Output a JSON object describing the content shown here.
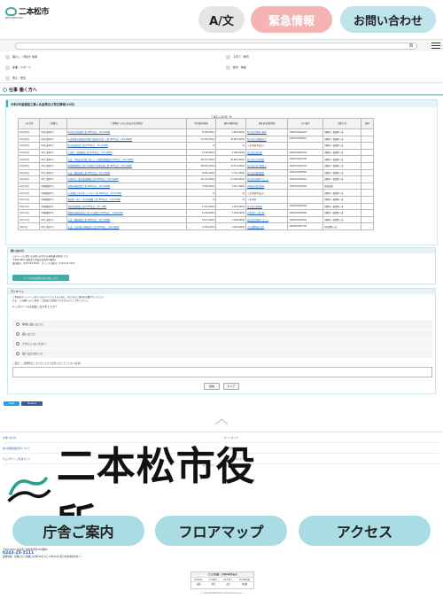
{
  "header": {
    "logo_text": "二本松市",
    "logo_sub": "NIHONMATSU",
    "lang_button": "A/文",
    "emergency_button": "緊急情報",
    "contact_button": "お問い合わせ"
  },
  "search": {
    "placeholder": "",
    "menu_label": "メニュー"
  },
  "category_nav": [
    {
      "label": "暮らし・手続き 情報"
    },
    {
      "label": "子育て・教育"
    },
    {
      "label": "産業・スポーツ"
    },
    {
      "label": "観光・物産"
    },
    {
      "label": "安心・安全"
    }
  ],
  "page_title": "仕事 働く方へ",
  "main": {
    "heading": "令和2年度建設工事入札結果及び発注情報(10月)",
    "caption": "工事等入札結果一覧",
    "columns": [
      "入札日等",
      "工事番号",
      "工事種名 [入札公告及び発注情報]",
      "予定価格(税抜)",
      "落札金額(税抜)",
      "落札者(結果詳細)",
      "法人番号",
      "契約方法",
      "備考"
    ],
    "rows": [
      [
        "10月26日",
        "2R水道第3号",
        "県水取水路耐震工事 [PDF形式：222.32KB]",
        "8,340,000円",
        "5,800,000円",
        "株式会社野崎工務所",
        "1000001009470",
        "制限付一般競争入札",
        ""
      ],
      [
        "10月26日",
        "2R水道第3号",
        "水道事業水資源保全事業 (東部浄水場) 工事 [PDF形式：219.69KB]",
        "53,050,000円",
        "45,800,000円",
        "株式会社安積組ほか",
        "5080001009819",
        "制限付一般競争入札",
        ""
      ],
      [
        "10月26日",
        "2R水道第3号",
        "配水施設修繕工事 [PDF形式：227.67KB]",
        "-円",
        "-円",
        "入札不調(不成立)",
        "-",
        "制限付一般競争入札",
        ""
      ],
      [
        "10月26日",
        "2R土木第3号",
        "土部里・道路整備工事 [PDF形式：217.99KB]",
        "4,550,000円",
        "4,480,000円",
        "株式会社清水組",
        "1000001009478",
        "制限付一般競争入札",
        ""
      ],
      [
        "10月26日",
        "2R土木第3号",
        "市道・学校安全対策工事 (入・供用施設整備) [PDF形式：222.58KB]",
        "28,537,000円",
        "20,800,000円",
        "株式会社丸実建設",
        "1000001005430",
        "制限付一般競争入札",
        ""
      ],
      [
        "10月26日",
        "2R土木第3号",
        "幹線管路施設工事 (大谷地区) 県道拡幅工事 [PDF形式：216.48KB]",
        "38,636,000円",
        "33,579,000円",
        "株式会社宮大建設工",
        "1000001007018",
        "制限付一般競争入札",
        ""
      ],
      [
        "10月26日",
        "2R土木第3号",
        "市道・舗装補修工事 [PDF形式：221.36KB]",
        "8,060,000円",
        "5,711,000円",
        "株式会社藤田建設",
        "1000001006856",
        "制限付一般競争入札",
        ""
      ],
      [
        "10月26日",
        "2R土木第3号",
        "市営住宅・集合施設整備工事 [PDF形式：223.16KB]",
        "14,521,000円",
        "14,000,000円",
        "株式会社新興アスコン",
        "1000001009516",
        "制限付一般競争入札",
        ""
      ],
      [
        "10月16日",
        "2R建築第3号",
        "道路区画線設置工事 [PDF形式：219.98KB]",
        "3,500,000円",
        "3,811,000円",
        "有限会社渡辺塗装",
        "1000001005834",
        "随意契約",
        ""
      ],
      [
        "10月12日",
        "2R建築第3号",
        "市道舗装工事水道 (上下水) 工事 [PDF形式：220.52KB]",
        "-円",
        "-円",
        "入札不調(不成立)",
        "-",
        "制限付一般競争入札",
        ""
      ],
      [
        "10月12日",
        "2R建築第3号",
        "東和第一排水・排水路整備工事 [PDF形式：218.39KB]",
        "-円",
        "-円",
        "入札不調",
        "-",
        "制限付一般競争入札",
        ""
      ],
      [
        "10月12日",
        "2R建築第3号",
        "消防施設整備工事 [PDF形式：221.1KB]",
        "1,551,000円",
        "1,500,000円",
        "株式会社佐藤組",
        "1000001009468",
        "制限付一般競争入札",
        ""
      ],
      [
        "10月12日",
        "2R建築第3号",
        "業務区画施設造成工事 (大谷地区) [PDF形式：218.31KB]",
        "6,294,000円",
        "5,260,000円",
        "有限会社三浦工務",
        "2000001008568",
        "制限付一般競争入札",
        ""
      ],
      [
        "10月12日",
        "2R土木第1号",
        "市道・舗装補修工事 [PDF形式：217.59KB]",
        "8,617,000円",
        "7,626,000円",
        "株式会社新興アスコン",
        "1000001009516",
        "制限付一般競争入札",
        ""
      ],
      [
        "10月5日",
        "2R土木第1号",
        "市道・大谷地区 道路改良工事 [PDF形式：230.29KB]",
        "2,536,000円",
        "2,260,000円",
        "大正建築株式会社",
        "4000001003756",
        "指名競争入札",
        ""
      ]
    ]
  },
  "inquiry": {
    "heading": "問い合わせ",
    "line1": "このページに関するお問い合わせは 財政課 契約係 です。",
    "line2": "〒964-8601 福島県二本松市金色403番地1",
    "line3": "電話番号：0243-55-5092　ファックス番号：0243-22-7023",
    "button": "メールでのお問い合わせはこちら"
  },
  "survey": {
    "heading": "アンケート",
    "intro1": "二本松市ホームページをより良いサイトにするために、皆さまのご意見をお聞かせください。",
    "intro2": "なお、この欄からのご意見・ご要望には回答できませんのでご了承ください。",
    "question": "Q.このページはお役に立ちましたか？",
    "options": [
      "非常に役に立った",
      "役に立った",
      "どちらともいえない",
      "役に立たなかった"
    ],
    "note": "ご意見・ご感想等がございましたら下記を入力してください(任意)",
    "submit": "送信",
    "clear": "クリア"
  },
  "share": {
    "twitter": "Tweet",
    "facebook": "Facebook"
  },
  "footer_nav": {
    "left": [
      "お問い合わせ",
      "個人情報保護方針について",
      "ウェブサイトご利用ガイド"
    ],
    "right": [
      "サイトマップ",
      "リンク集",
      "ウェブアクセシビリティ"
    ]
  },
  "linkbar": "表示：スマートフォン版 | パソコン版",
  "city_logo": "二本松市役所",
  "footer_buttons": [
    "庁舎ご案内",
    "フロアマップ",
    "アクセス"
  ],
  "address": {
    "line1": "〒964-8601 福島県二本松市金色403番地1",
    "tel": "0243-23-1111",
    "line2": "業務時間：月曜日から金曜日の8時30分から17時15分(祝日年末年始を除く)"
  },
  "counter": {
    "heading": "人口と世帯数　(令和2年8月末日)",
    "values": [
      "54,044人",
      "27,006人",
      "26,743人",
      "20,569世帯"
    ],
    "labels": [
      "総数",
      "男性",
      "女性",
      "世帯数"
    ]
  },
  "copyright": "© 2020 NIHONMATSU All Rights Reserved."
}
